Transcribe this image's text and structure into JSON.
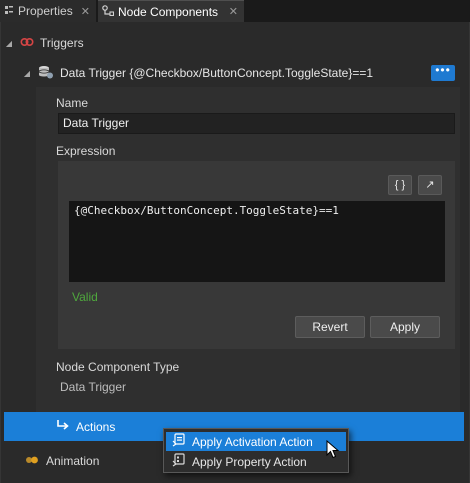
{
  "tabs": [
    {
      "label": "Properties",
      "active": false
    },
    {
      "label": "Node Components",
      "active": true
    }
  ],
  "triggers": {
    "label": "Triggers"
  },
  "data_trigger": {
    "label": "Data Trigger {@Checkbox/ButtonConcept.ToggleState}==1",
    "more_button": "•••",
    "name_label": "Name",
    "name_value": "Data Trigger",
    "expression_label": "Expression",
    "expression_value": "{@Checkbox/ButtonConcept.ToggleState}==1",
    "braces_button": "{ }",
    "expand_button": "↗",
    "status": "Valid",
    "revert_button": "Revert",
    "apply_button": "Apply",
    "type_label": "Node Component Type",
    "type_value": "Data Trigger"
  },
  "actions": {
    "label": "Actions"
  },
  "animation": {
    "label": "Animation"
  },
  "context_menu": {
    "items": [
      {
        "label": "Apply Activation Action",
        "highlighted": true
      },
      {
        "label": "Apply Property Action",
        "highlighted": false
      }
    ]
  },
  "colors": {
    "accent": "#1b7fd8",
    "valid": "#4fa83d",
    "trigger_icon": "#d64545",
    "animation_icon": "#e0a020"
  }
}
